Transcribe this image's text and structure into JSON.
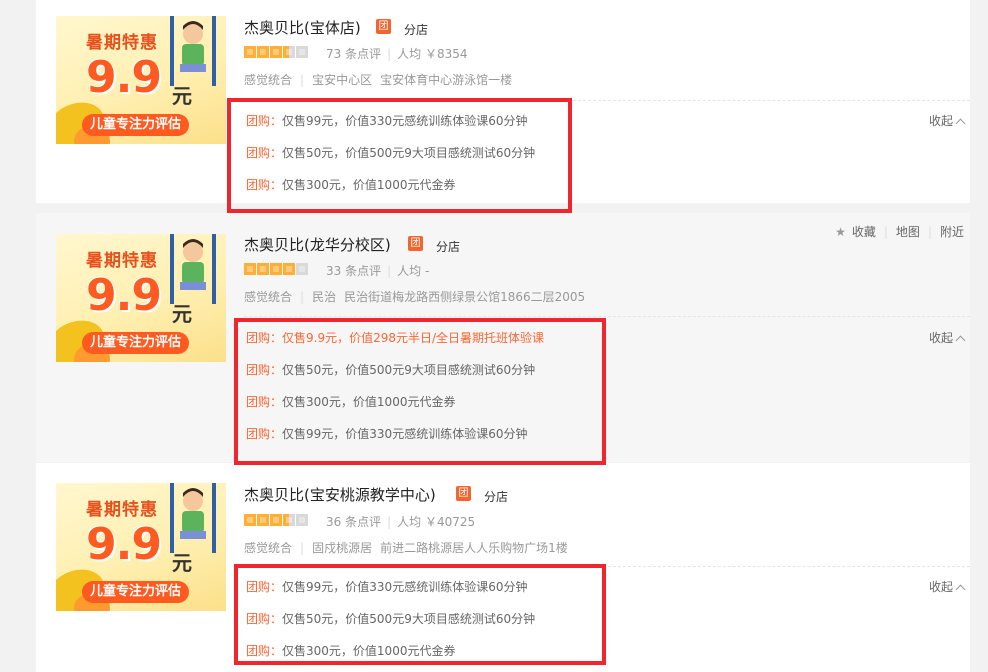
{
  "thumbnail": {
    "banner_top": "暑期特惠",
    "big_price": "9.9",
    "unit": "元",
    "pill": "儿童专注力评估"
  },
  "shops": [
    {
      "name": "杰奥贝比(宝体店)",
      "tuan_badge": "团",
      "branch_label": "分店",
      "reviews": "73 条点评",
      "avg_price": "人均 ￥8354",
      "category": "感觉统合",
      "district": "宝安中心区",
      "address": "宝安体育中心游泳馆一楼",
      "rating_stars": 3.5,
      "deals": [
        {
          "tag": "团购：",
          "text": "仅售99元，价值330元感统训练体验课60分钟"
        },
        {
          "tag": "团购：",
          "text": "仅售50元，价值500元9大项目感统测试60分钟"
        },
        {
          "tag": "团购：",
          "text": "仅售300元，价值1000元代金券"
        }
      ],
      "collapse_label": "收起"
    },
    {
      "name": "杰奥贝比(龙华分校区)",
      "tuan_badge": "团",
      "branch_label": "分店",
      "reviews": "33 条点评",
      "avg_price": "人均 -",
      "category": "感觉统合",
      "district": "民治",
      "address": "民治街道梅龙路西侧绿景公馆1866二层2005",
      "rating_stars": 4,
      "deals": [
        {
          "tag": "团购：",
          "text": "仅售9.9元，价值298元半日/全日暑期托班体验课"
        },
        {
          "tag": "团购：",
          "text": "仅售50元，价值500元9大项目感统测试60分钟"
        },
        {
          "tag": "团购：",
          "text": "仅售300元，价值1000元代金券"
        },
        {
          "tag": "团购：",
          "text": "仅售99元，价值330元感统训练体验课60分钟"
        }
      ],
      "collapse_label": "收起",
      "tools": {
        "favorite": "收藏",
        "map": "地图",
        "nearby": "附近"
      }
    },
    {
      "name": "杰奥贝比(宝安桃源教学中心)",
      "tuan_badge": "团",
      "branch_label": "分店",
      "reviews": "36 条点评",
      "avg_price": "人均 ￥40725",
      "category": "感觉统合",
      "district": "固戍桃源居",
      "address": "前进二路桃源居人人乐购物广场1楼",
      "rating_stars": 3.5,
      "deals": [
        {
          "tag": "团购：",
          "text": "仅售99元，价值330元感统训练体验课60分钟"
        },
        {
          "tag": "团购：",
          "text": "仅售50元，价值500元9大项目感统测试60分钟"
        },
        {
          "tag": "团购：",
          "text": "仅售300元，价值1000元代金券"
        }
      ],
      "collapse_label": "收起"
    }
  ],
  "colors": {
    "highlight_box": "#f0262e",
    "deal_tag": "#ff6633",
    "star_fill": "#ffae36",
    "tuan_badge": "#f26531"
  }
}
